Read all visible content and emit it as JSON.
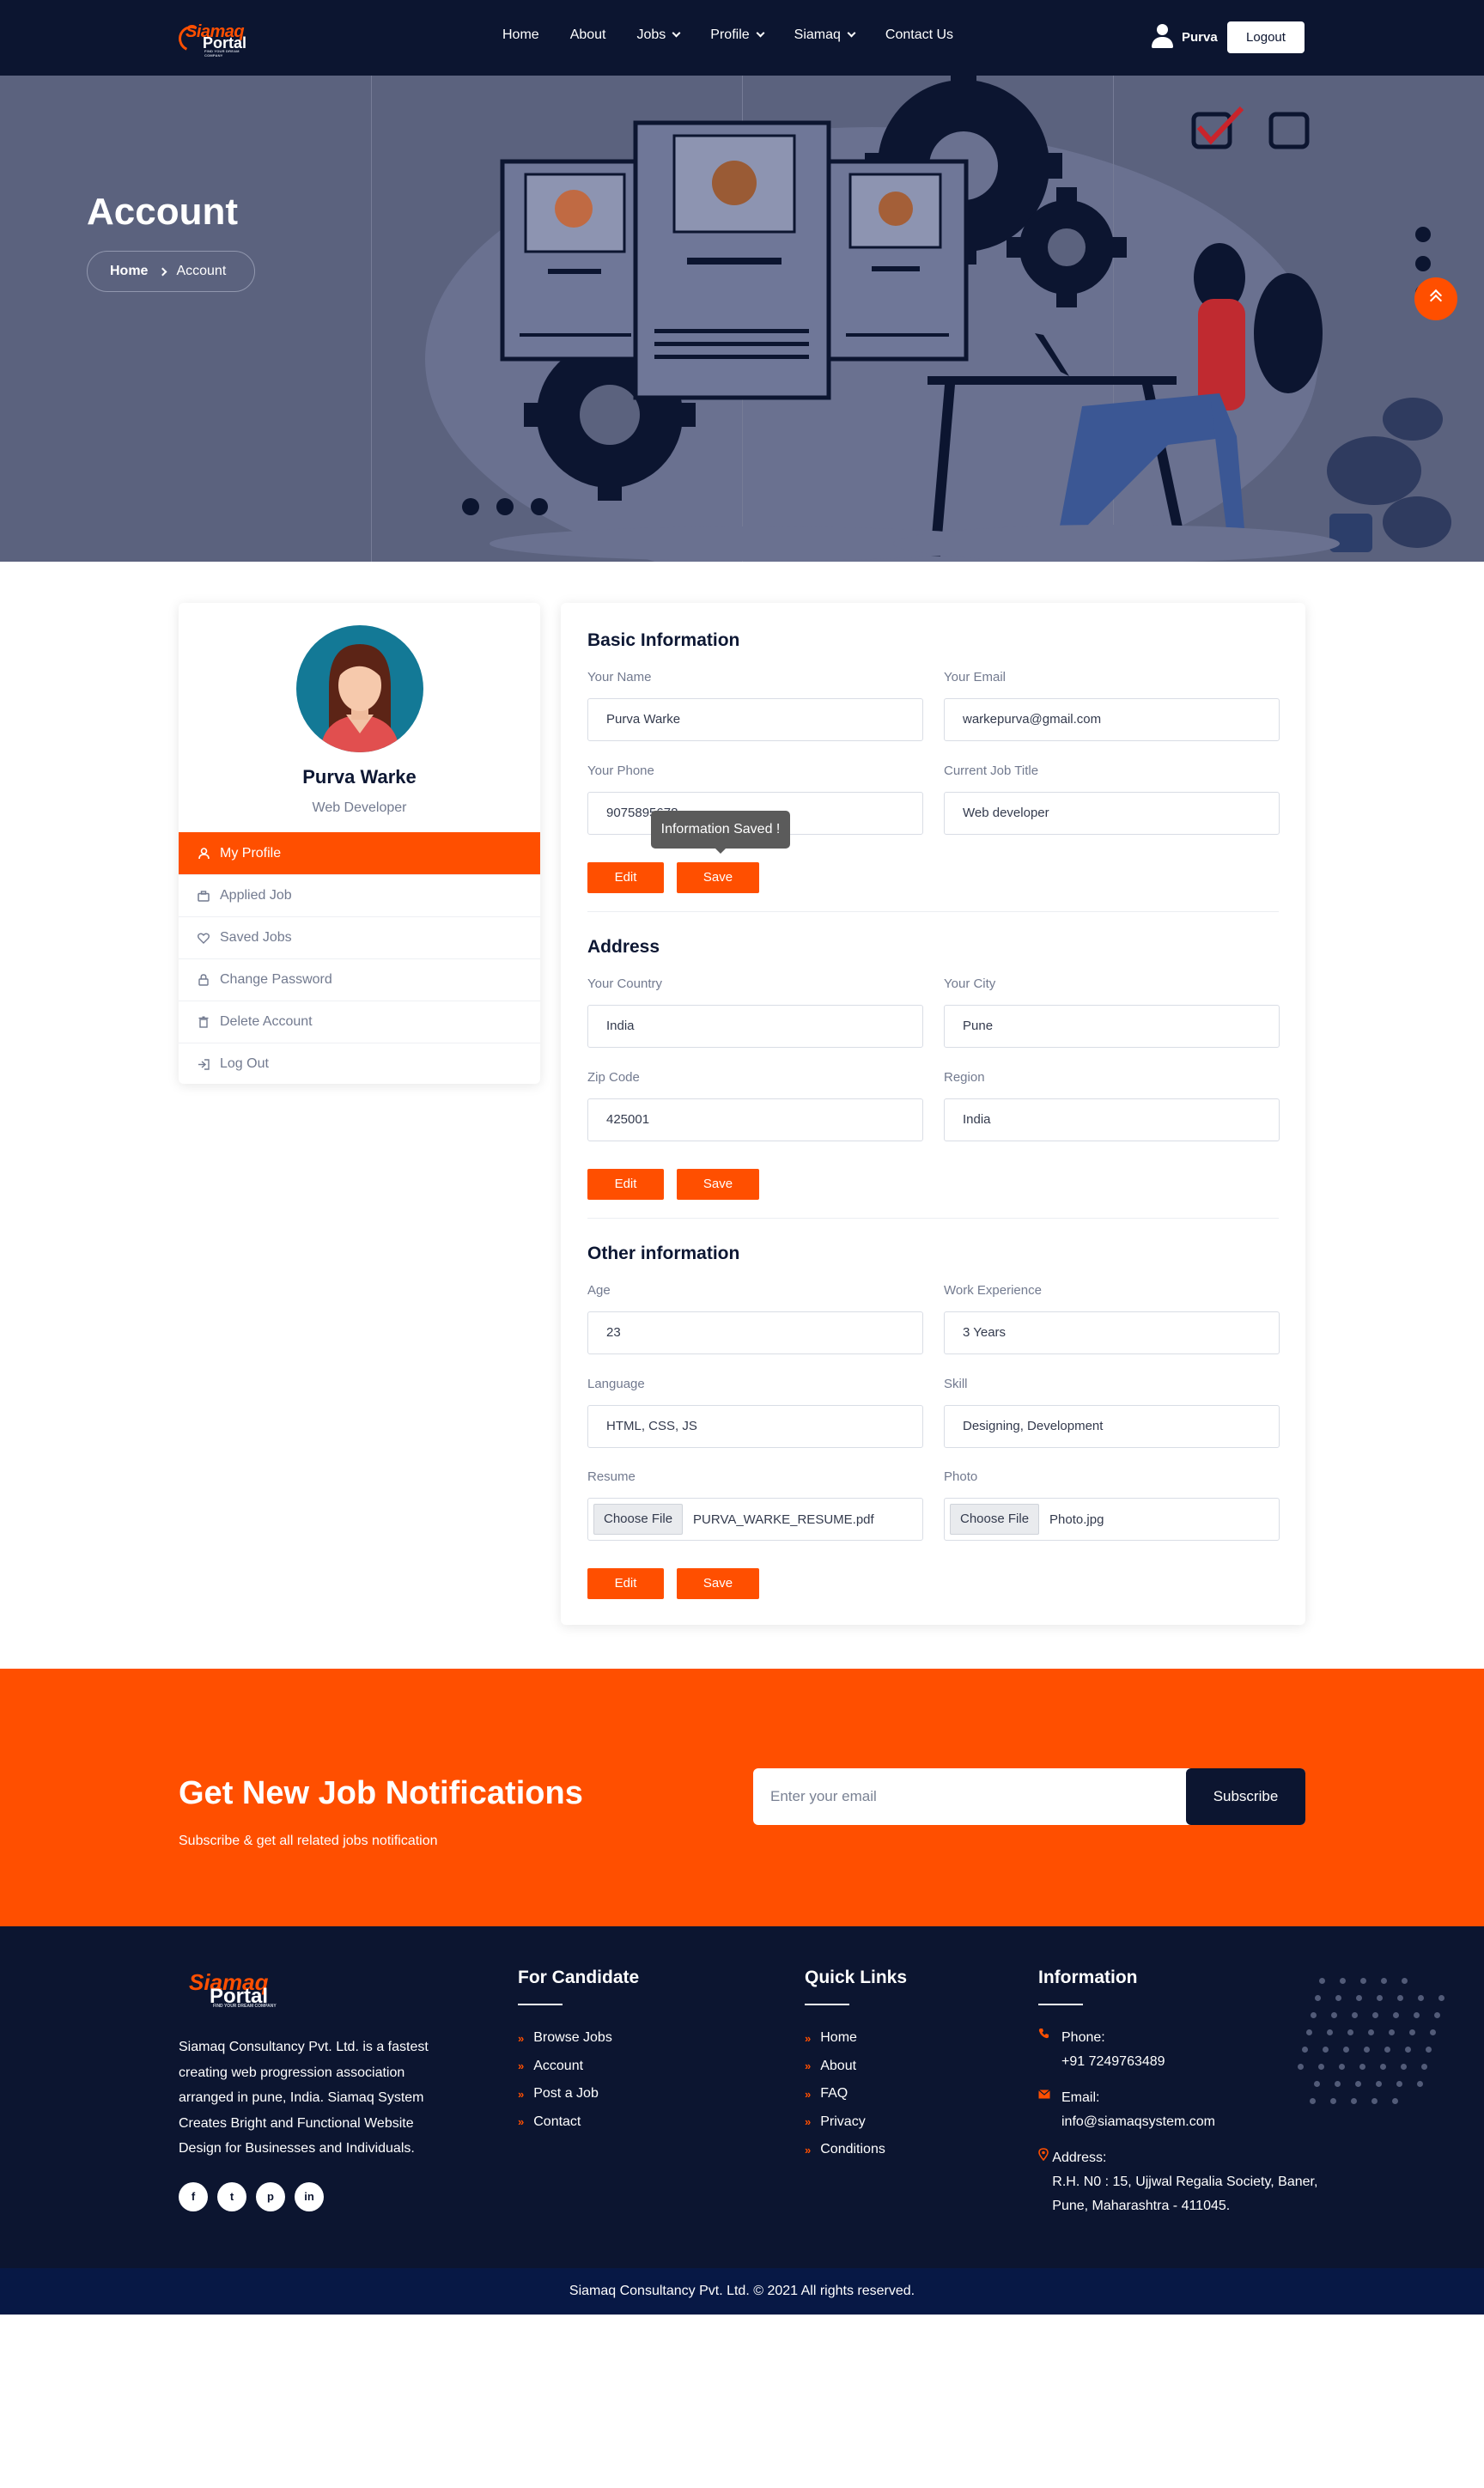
{
  "brand": {
    "logo_word1": "Siamaq",
    "logo_word2": "Portal",
    "logo_tagline": "FIND YOUR DREAM COMPANY"
  },
  "nav": {
    "items": [
      {
        "label": "Home"
      },
      {
        "label": "About"
      },
      {
        "label": "Jobs"
      },
      {
        "label": "Profile"
      },
      {
        "label": "Siamaq"
      },
      {
        "label": "Contact Us"
      }
    ],
    "username": "Purva",
    "logout_label": "Logout"
  },
  "hero": {
    "title": "Account",
    "breadcrumb_home": "Home",
    "breadcrumb_current": "Account"
  },
  "profile": {
    "name": "Purva Warke",
    "role": "Web Developer",
    "menu": [
      {
        "label": "My Profile",
        "icon": "user-icon"
      },
      {
        "label": "Applied Job",
        "icon": "briefcase-icon"
      },
      {
        "label": "Saved Jobs",
        "icon": "heart-icon"
      },
      {
        "label": "Change Password",
        "icon": "lock-icon"
      },
      {
        "label": "Delete Account",
        "icon": "trash-icon"
      },
      {
        "label": "Log Out",
        "icon": "logout-icon"
      }
    ]
  },
  "basic": {
    "title": "Basic Information",
    "name_label": "Your Name",
    "name_value": "Purva Warke",
    "email_label": "Your Email",
    "email_value": "warkepurva@gmail.com",
    "phone_label": "Your Phone",
    "phone_value": "9075895678",
    "job_label": "Current Job Title",
    "job_value": "Web developer",
    "tooltip": "Information Saved !"
  },
  "address": {
    "title": "Address",
    "country_label": "Your Country",
    "country_value": "India",
    "city_label": "Your City",
    "city_value": "Pune",
    "zip_label": "Zip Code",
    "zip_value": "425001",
    "region_label": "Region",
    "region_value": "India"
  },
  "other": {
    "title": "Other information",
    "age_label": "Age",
    "age_value": "23",
    "exp_label": "Work Experience",
    "exp_value": "3 Years",
    "lang_label": "Language",
    "lang_value": "HTML, CSS, JS",
    "skill_label": "Skill",
    "skill_value": "Designing, Development",
    "resume_label": "Resume",
    "resume_file": "PURVA_WARKE_RESUME.pdf",
    "photo_label": "Photo",
    "photo_file": "Photo.jpg",
    "choose_file_label": "Choose File"
  },
  "buttons": {
    "edit": "Edit",
    "save": "Save"
  },
  "newsletter": {
    "title": "Get New Job Notifications",
    "subtitle": "Subscribe & get all related jobs notification",
    "placeholder": "Enter your email",
    "button": "Subscribe"
  },
  "footer": {
    "about": "Siamaq Consultancy Pvt. Ltd. is a fastest creating web progression association arranged in pune, India. Siamaq System Creates Bright and Functional Website Design for Businesses and Individuals.",
    "social": [
      {
        "icon": "facebook-icon",
        "glyph": "f"
      },
      {
        "icon": "twitter-icon",
        "glyph": "t"
      },
      {
        "icon": "pinterest-icon",
        "glyph": "p"
      },
      {
        "icon": "linkedin-icon",
        "glyph": "in"
      }
    ],
    "candidate_title": "For Candidate",
    "candidate_links": [
      "Browse Jobs",
      "Account",
      "Post a Job",
      "Contact"
    ],
    "quick_title": "Quick Links",
    "quick_links": [
      "Home",
      "About",
      "FAQ",
      "Privacy",
      "Conditions"
    ],
    "info_title": "Information",
    "phone_label": "Phone:",
    "phone_value": "+91 7249763489",
    "email_label": "Email:",
    "email_value": "info@siamaqsystem.com",
    "address_label": "Address:",
    "address_value": "R.H. N0 : 15, Ujjwal Regalia Society, Baner, Pune, Maharashtra - 411045.",
    "copyright": "Siamaq Consultancy Pvt. Ltd. © 2021 All rights reserved."
  },
  "colors": {
    "accent": "#ff4f00",
    "navy": "#0c1530",
    "hero_bg": "#5b627e"
  }
}
